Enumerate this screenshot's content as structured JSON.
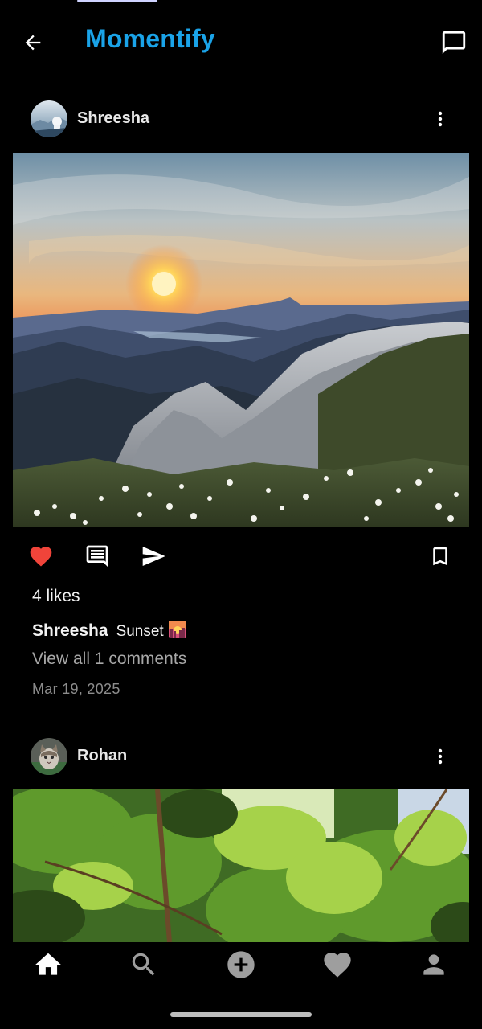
{
  "app": {
    "title": "Momentify"
  },
  "posts": [
    {
      "username": "Shreesha",
      "likes": "4 likes",
      "caption_user": "Shreesha",
      "caption_text": "Sunset",
      "view_comments": "View all 1 comments",
      "date": "Mar 19, 2025",
      "liked": true
    },
    {
      "username": "Rohan"
    }
  ],
  "icons": {
    "back": "arrow-back-icon",
    "chat": "chat-bubble-icon",
    "more": "more-vertical-icon",
    "like": "heart-icon",
    "comment": "comment-icon",
    "share": "send-icon",
    "save": "bookmark-icon",
    "nav_home": "home-icon",
    "nav_search": "search-icon",
    "nav_add": "add-circle-icon",
    "nav_activity": "heart-icon",
    "nav_profile": "person-icon"
  },
  "colors": {
    "accent": "#1aa3e8",
    "like_active": "#f0443a",
    "background": "#000000"
  }
}
